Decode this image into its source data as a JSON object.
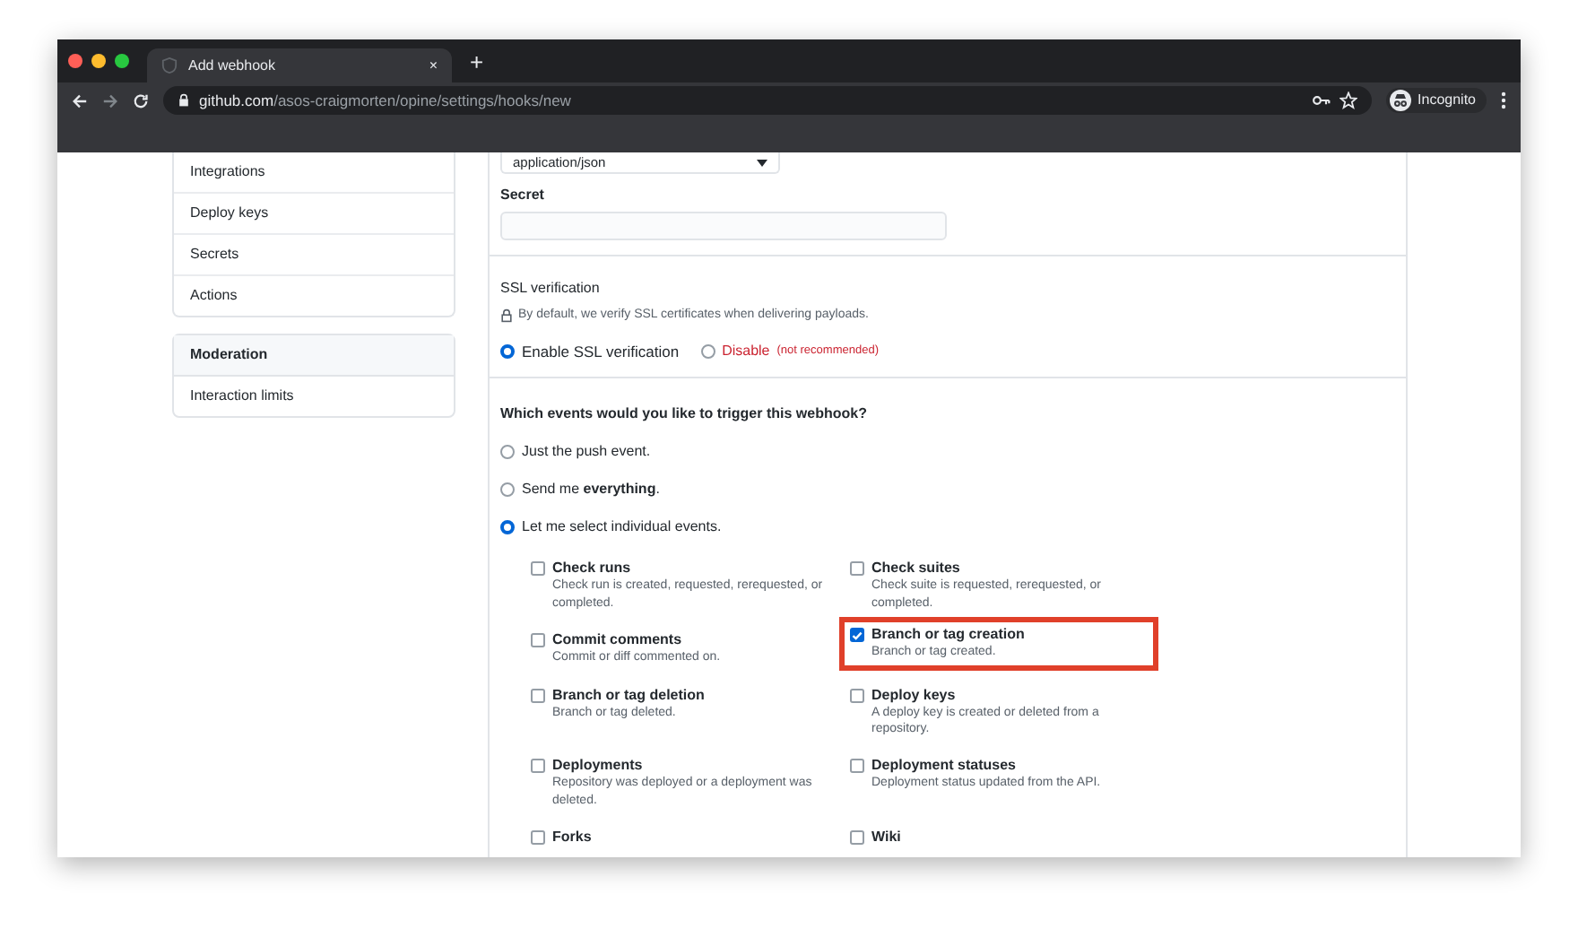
{
  "browser": {
    "tab_title": "Add webhook",
    "tab_close": "×",
    "new_tab": "+",
    "url_domain": "github.com",
    "url_path": "/asos-craigmorten/opine/settings/hooks/new",
    "profile_label": "Incognito"
  },
  "sidebar": {
    "sections": [
      {
        "items": [
          "Integrations",
          "Deploy keys",
          "Secrets",
          "Actions"
        ]
      },
      {
        "heading": "Moderation",
        "items": [
          "Interaction limits"
        ]
      }
    ]
  },
  "form": {
    "content_type": "application/json",
    "secret_label": "Secret",
    "ssl": {
      "title": "SSL verification",
      "note": "By default, we verify SSL certificates when delivering payloads.",
      "options": [
        {
          "label": "Enable SSL verification",
          "kind": "normal",
          "selected": true
        },
        {
          "label": "Disable",
          "note": "(not recommended)",
          "kind": "danger",
          "selected": false
        }
      ]
    },
    "events": {
      "question": "Which events would you like to trigger this webhook?",
      "options": [
        {
          "label": "Just the push event.",
          "selected": false
        },
        {
          "label": "Send me **everything**.",
          "selected": false
        },
        {
          "label": "Let me select individual events.",
          "selected": true
        }
      ],
      "items": [
        {
          "title": "Check runs",
          "description": "Check run is created, requested, rerequested, or completed.",
          "checked": false,
          "highlighted": false
        },
        {
          "title": "Check suites",
          "description": "Check suite is requested, rerequested, or completed.",
          "checked": false,
          "highlighted": false
        },
        {
          "title": "Commit comments",
          "description": "Commit or diff commented on.",
          "checked": false,
          "highlighted": false
        },
        {
          "title": "Branch or tag creation",
          "description": "Branch or tag created.",
          "checked": true,
          "highlighted": true
        },
        {
          "title": "Branch or tag deletion",
          "description": "Branch or tag deleted.",
          "checked": false,
          "highlighted": false
        },
        {
          "title": "Deploy keys",
          "description": "A deploy key is created or deleted from a repository.",
          "checked": false,
          "highlighted": false
        },
        {
          "title": "Deployments",
          "description": "Repository was deployed or a deployment was deleted.",
          "checked": false,
          "highlighted": false
        },
        {
          "title": "Deployment statuses",
          "description": "Deployment status updated from the API.",
          "checked": false,
          "highlighted": false
        },
        {
          "title": "Forks",
          "checked": false,
          "highlighted": false
        },
        {
          "title": "Wiki",
          "checked": false,
          "highlighted": false
        }
      ]
    }
  }
}
